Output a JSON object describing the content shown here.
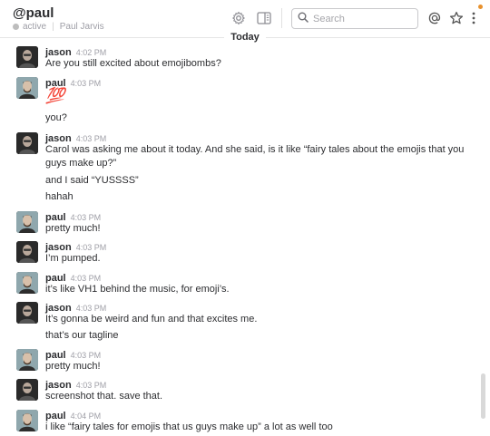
{
  "channel": {
    "name": "@paul",
    "status": "active",
    "full_name": "Paul Jarvis"
  },
  "header": {
    "settings_icon": "gear-icon",
    "details_icon": "sidebar-panel-icon",
    "search_icon": "search-icon",
    "mentions_icon": "at-icon",
    "star_icon": "star-icon",
    "more_icon": "vertical-dots-icon",
    "accent_dot_color": "#e8912d"
  },
  "search": {
    "placeholder": "Search"
  },
  "day_divider": {
    "label": "Today"
  },
  "messages": [
    {
      "author": "jason",
      "time": "4:02 PM",
      "lines": [
        "Are you still excited about emojibombs?"
      ]
    },
    {
      "author": "paul",
      "time": "4:03 PM",
      "lines": [
        "💯",
        "you?"
      ]
    },
    {
      "author": "jason",
      "time": "4:03 PM",
      "lines": [
        "Carol was asking me about it today. And she said, is it like “fairy tales about the emojis that you",
        "guys make up?”",
        "and I said “YUSSSS”",
        "hahah"
      ]
    },
    {
      "author": "paul",
      "time": "4:03 PM",
      "lines": [
        "pretty much!"
      ]
    },
    {
      "author": "jason",
      "time": "4:03 PM",
      "lines": [
        "I’m pumped."
      ]
    },
    {
      "author": "paul",
      "time": "4:03 PM",
      "lines": [
        "it’s like VH1 behind the music, for emoji’s."
      ]
    },
    {
      "author": "jason",
      "time": "4:03 PM",
      "lines": [
        "It’s gonna be weird and fun and that excites me.",
        "that’s our tagline"
      ]
    },
    {
      "author": "paul",
      "time": "4:03 PM",
      "lines": [
        "pretty much!"
      ]
    },
    {
      "author": "jason",
      "time": "4:03 PM",
      "lines": [
        "screenshot that. save that."
      ]
    },
    {
      "author": "paul",
      "time": "4:04 PM",
      "lines": [
        "i like “fairy tales for emojis that us guys make up” a lot as well too"
      ]
    }
  ]
}
